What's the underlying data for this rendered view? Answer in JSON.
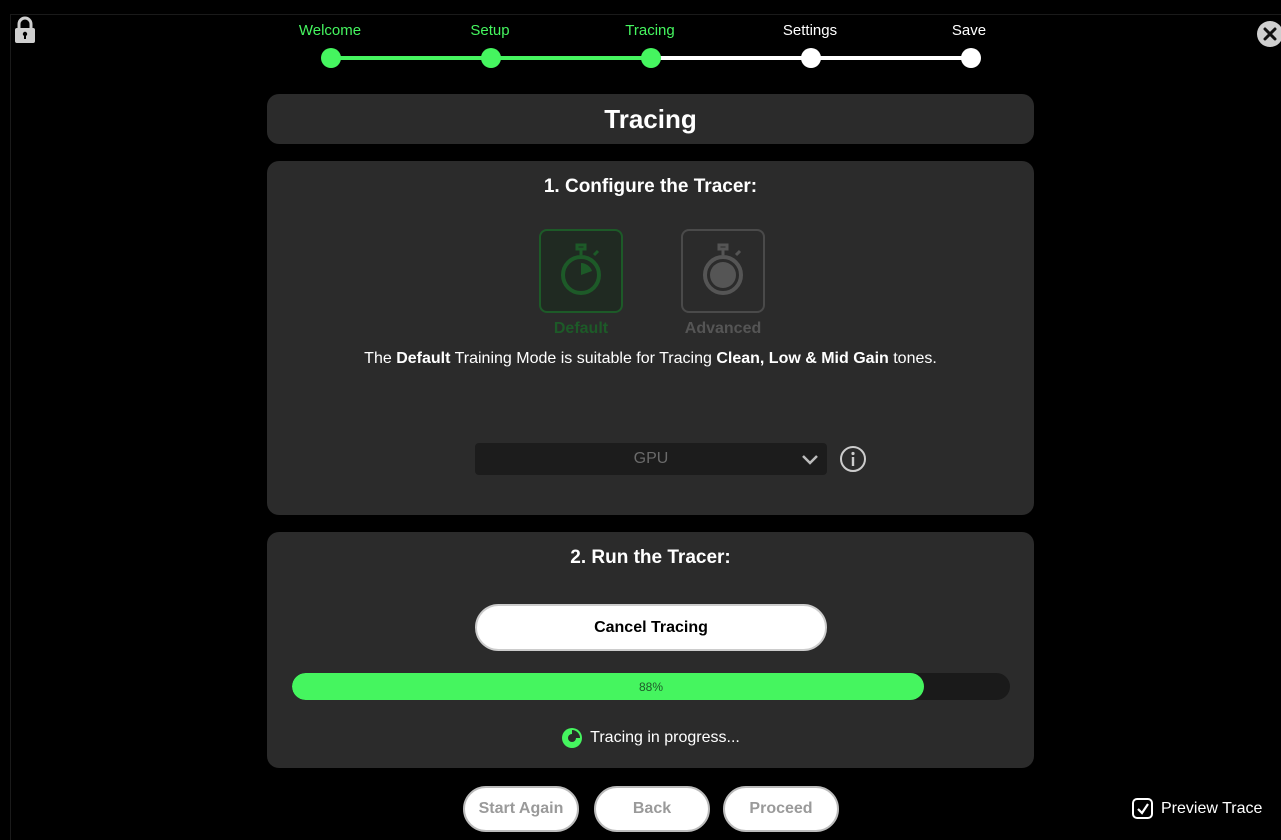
{
  "stepper": {
    "steps": [
      {
        "label": "Welcome",
        "state": "done"
      },
      {
        "label": "Setup",
        "state": "done"
      },
      {
        "label": "Tracing",
        "state": "current"
      },
      {
        "label": "Settings",
        "state": "todo"
      },
      {
        "label": "Save",
        "state": "todo"
      }
    ],
    "done_color": "#45f55f",
    "todo_color": "#ffffff"
  },
  "header": {
    "title": "Tracing"
  },
  "configure": {
    "heading": "1. Configure the Tracer:",
    "modes": [
      {
        "label": "Default",
        "icon": "stopwatch-icon",
        "selected": true
      },
      {
        "label": "Advanced",
        "icon": "stopwatch-icon",
        "selected": false
      }
    ],
    "description": {
      "prefix": "The ",
      "mode": "Default",
      "middle": " Training Mode is suitable for Tracing ",
      "tones": "Clean, Low & Mid Gain",
      "suffix": " tones."
    },
    "device_select": {
      "value": "GPU"
    }
  },
  "run": {
    "heading": "2. Run the Tracer:",
    "cancel_label": "Cancel Tracing",
    "progress_text": "88%",
    "progress_value": 0.88,
    "status": "Tracing in progress..."
  },
  "footer": {
    "start_again_label": "Start Again",
    "back_label": "Back",
    "proceed_label": "Proceed",
    "preview_label": "Preview Trace",
    "preview_checked": true
  },
  "colors": {
    "accent": "#45f55f",
    "panel": "#2b2b2b",
    "background": "#000000"
  }
}
